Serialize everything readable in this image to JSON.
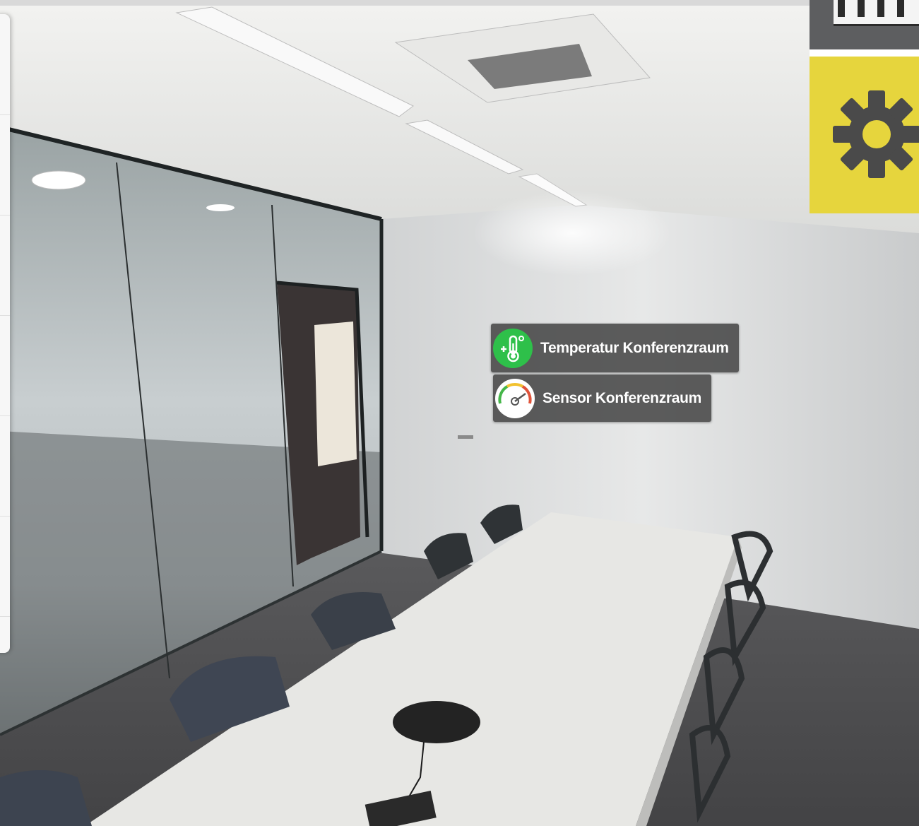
{
  "hotspots": {
    "temperature": {
      "label": "Temperatur Konferenzraum",
      "icon": "thermometer-icon",
      "icon_color": "#2ec04a"
    },
    "sensor": {
      "label": "Sensor Konferenzraum",
      "icon": "gauge-icon"
    }
  },
  "menu": {
    "settings_icon": "gear-icon",
    "accent_color": "#e6d53d",
    "dark_color": "#5d5e60"
  },
  "scene": {
    "type": "360-panorama-viewer",
    "subject": "conference room"
  }
}
